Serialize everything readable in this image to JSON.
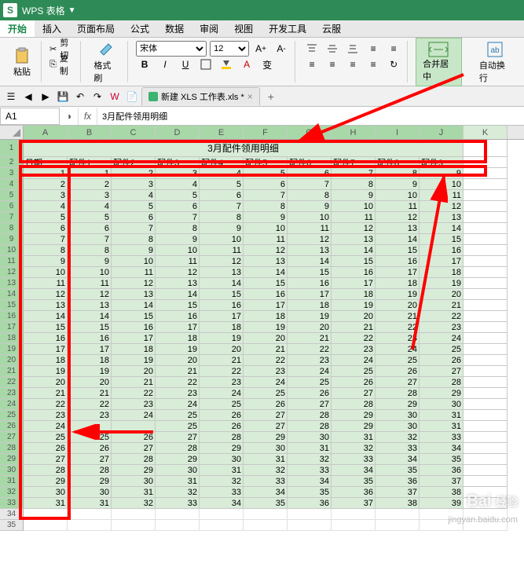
{
  "titlebar": {
    "app": "WPS 表格",
    "dropdown": "▼"
  },
  "menu": {
    "items": [
      "开始",
      "插入",
      "页面布局",
      "公式",
      "数据",
      "审阅",
      "视图",
      "开发工具",
      "云服"
    ],
    "active_index": 0
  },
  "ribbon": {
    "paste": "粘贴",
    "cut": "剪切",
    "copy": "复制",
    "format_painter": "格式刷",
    "font_name": "宋体",
    "font_size": "12",
    "bold": "B",
    "italic": "I",
    "underline": "U",
    "merge_cells": "合并居中",
    "wrap_text": "自动换行"
  },
  "doctab": {
    "name": "新建 XLS 工作表.xls *"
  },
  "formula": {
    "cell_ref": "A1",
    "value": "3月配件领用明细"
  },
  "columns": [
    "A",
    "B",
    "C",
    "D",
    "E",
    "F",
    "G",
    "H",
    "I",
    "J",
    "K"
  ],
  "sheet_title": "3月配件领用明细",
  "headers": [
    "日期",
    "配件1",
    "配件2",
    "配件3",
    "配件4",
    "配件5",
    "配件6",
    "配件7",
    "配件8",
    "配件9"
  ],
  "chart_data": {
    "type": "table",
    "title": "3月配件领用明细",
    "columns": [
      "日期",
      "配件1",
      "配件2",
      "配件3",
      "配件4",
      "配件5",
      "配件6",
      "配件7",
      "配件8",
      "配件9"
    ],
    "rows": [
      [
        1,
        1,
        2,
        3,
        4,
        5,
        6,
        7,
        8,
        9
      ],
      [
        2,
        2,
        3,
        4,
        5,
        6,
        7,
        8,
        9,
        10
      ],
      [
        3,
        3,
        4,
        5,
        6,
        7,
        8,
        9,
        10,
        11
      ],
      [
        4,
        4,
        5,
        6,
        7,
        8,
        9,
        10,
        11,
        12
      ],
      [
        5,
        5,
        6,
        7,
        8,
        9,
        10,
        11,
        12,
        13
      ],
      [
        6,
        6,
        7,
        8,
        9,
        10,
        11,
        12,
        13,
        14
      ],
      [
        7,
        7,
        8,
        9,
        10,
        11,
        12,
        13,
        14,
        15
      ],
      [
        8,
        8,
        9,
        10,
        11,
        12,
        13,
        14,
        15,
        16
      ],
      [
        9,
        9,
        10,
        11,
        12,
        13,
        14,
        15,
        16,
        17
      ],
      [
        10,
        10,
        11,
        12,
        13,
        14,
        15,
        16,
        17,
        18
      ],
      [
        11,
        11,
        12,
        13,
        14,
        15,
        16,
        17,
        18,
        19
      ],
      [
        12,
        12,
        13,
        14,
        15,
        16,
        17,
        18,
        19,
        20
      ],
      [
        13,
        13,
        14,
        15,
        16,
        17,
        18,
        19,
        20,
        21
      ],
      [
        14,
        14,
        15,
        16,
        17,
        18,
        19,
        20,
        21,
        22
      ],
      [
        15,
        15,
        16,
        17,
        18,
        19,
        20,
        21,
        22,
        23
      ],
      [
        16,
        16,
        17,
        18,
        19,
        20,
        21,
        22,
        23,
        24
      ],
      [
        17,
        17,
        18,
        19,
        20,
        21,
        22,
        23,
        24,
        25
      ],
      [
        18,
        18,
        19,
        20,
        21,
        22,
        23,
        24,
        25,
        26
      ],
      [
        19,
        19,
        20,
        21,
        22,
        23,
        24,
        25,
        26,
        27
      ],
      [
        20,
        20,
        21,
        22,
        23,
        24,
        25,
        26,
        27,
        28
      ],
      [
        21,
        21,
        22,
        23,
        24,
        25,
        26,
        27,
        28,
        29
      ],
      [
        22,
        22,
        23,
        24,
        25,
        26,
        27,
        28,
        29,
        30
      ],
      [
        23,
        23,
        24,
        25,
        26,
        27,
        28,
        29,
        30,
        31
      ],
      [
        24,
        "",
        "",
        25,
        26,
        27,
        28,
        29,
        30,
        31
      ],
      [
        25,
        25,
        26,
        27,
        28,
        29,
        30,
        31,
        32,
        33
      ],
      [
        26,
        26,
        27,
        28,
        29,
        30,
        31,
        32,
        33,
        34
      ],
      [
        27,
        27,
        28,
        29,
        30,
        31,
        32,
        33,
        34,
        35
      ],
      [
        28,
        28,
        29,
        30,
        31,
        32,
        33,
        34,
        35,
        36
      ],
      [
        29,
        29,
        30,
        31,
        32,
        33,
        34,
        35,
        36,
        37
      ],
      [
        30,
        30,
        31,
        32,
        33,
        34,
        35,
        36,
        37,
        38
      ],
      [
        31,
        31,
        32,
        33,
        34,
        35,
        36,
        37,
        38,
        39
      ]
    ]
  },
  "watermark": {
    "brand": "Bai",
    "brand2": "经验",
    "url": "jingyan.baidu.com"
  }
}
